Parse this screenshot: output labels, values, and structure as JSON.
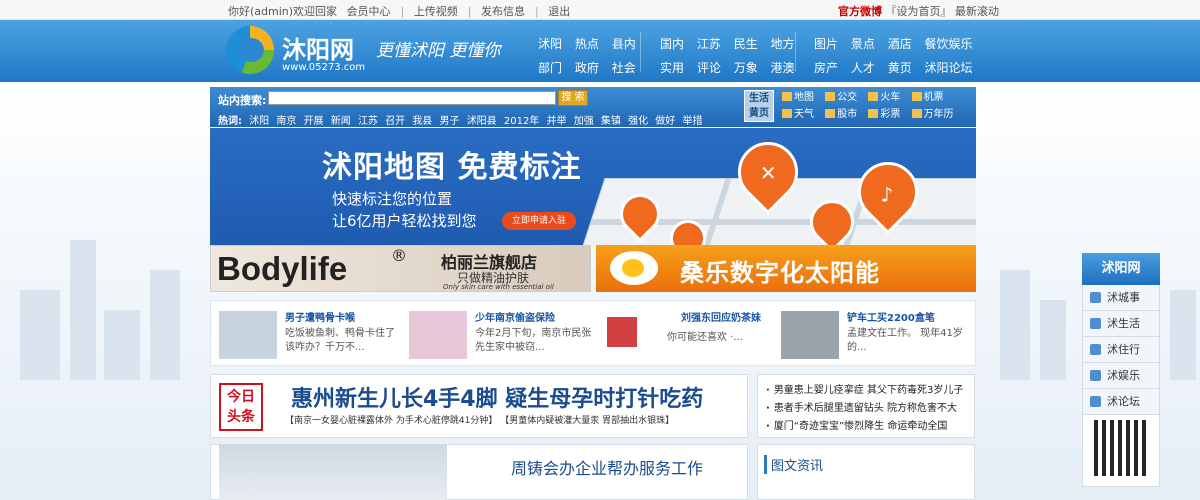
{
  "topbar": {
    "greeting": "你好(admin)欢迎回家",
    "links": [
      "会员中心",
      "上传视频",
      "发布信息",
      "退出"
    ],
    "weibo": "官方微博",
    "set_home": "『设为首页』",
    "scroll": "最新滚动"
  },
  "header": {
    "site_name": "沐阳网",
    "site_url": "www.05273.com",
    "slogan": "更懂沭阳 更懂你",
    "nav1": {
      "row1": [
        "沭阳",
        "热点",
        "县内"
      ],
      "row2": [
        "部门",
        "政府",
        "社会"
      ]
    },
    "nav2": {
      "row1": [
        "国内",
        "江苏",
        "民生",
        "地方"
      ],
      "row2": [
        "实用",
        "评论",
        "万象",
        "港澳"
      ]
    },
    "nav3": {
      "row1": [
        "图片",
        "景点",
        "酒店",
        "餐饮娱乐"
      ],
      "row2": [
        "房产",
        "人才",
        "黄页",
        "沭阳论坛"
      ]
    }
  },
  "search": {
    "label": "站内搜索:",
    "value": "",
    "button": "搜 索",
    "hot_label": "热词:",
    "hot_words": [
      "沭阳",
      "南京",
      "开展",
      "新闻",
      "江苏",
      "召开",
      "我县",
      "男子",
      "沭阳县",
      "2012年",
      "并举",
      "加强",
      "集镇",
      "强化",
      "做好",
      "举措"
    ],
    "life_badge": "生活黄页",
    "life_row1": [
      "地图",
      "公交",
      "火车",
      "机票"
    ],
    "life_row2": [
      "天气",
      "股市",
      "彩票",
      "万年历"
    ]
  },
  "banner": {
    "title": "沭阳地图 免费标注",
    "sub1": "快速标注您的位置",
    "sub2": "让6亿用户轻松找到您",
    "button": "立即申请入驻"
  },
  "ads": {
    "left_brand": "Bodylife",
    "left_reg": "®",
    "left_cn": "柏丽兰旗舰店",
    "left_cn2": "只做精油护肤",
    "left_en": "Only skin care with essential oil",
    "right_text": "桑乐数字化太阳能"
  },
  "news_strip": [
    {
      "title": "男子遭鸭骨卡喉",
      "desc": "吃饭被鱼刺、鸭骨卡住了该咋办？千万不..."
    },
    {
      "title": "少年南京偷盗保险",
      "desc": "今年2月下旬，南京市民张先生家中被窃..."
    },
    {
      "title": "刘强东回应奶茶妹",
      "desc": "你可能还喜欢 ·..."
    },
    {
      "title": "铲车工买2200盒笔",
      "desc": "孟建文在工作。 现年41岁的..."
    }
  ],
  "headline": {
    "tag": "今日头条",
    "title": "惠州新生儿长4手4脚 疑生母孕时打针吃药",
    "sub1": "【南京一女婴心脏裸露体外 为手术心脏停跳41分钟】",
    "sub2": "【男童体内疑被灌大量汞 胃部抽出水银珠】"
  },
  "side_news": [
    "男童患上婴儿痉挛症 其父下药毒死3岁儿子",
    "患者手术后腿里遗留钻头 院方称危害不大",
    "厦门“奇迹宝宝”惨烈降生 命运牵动全国"
  ],
  "bottom": {
    "title": "周铸会办企业帮办服务工作",
    "right_head": "图文资讯"
  },
  "floatbar": {
    "head": "沭阳网",
    "items": [
      "沭城事",
      "沭生活",
      "沭住行",
      "沭娱乐",
      "沭论坛"
    ]
  }
}
